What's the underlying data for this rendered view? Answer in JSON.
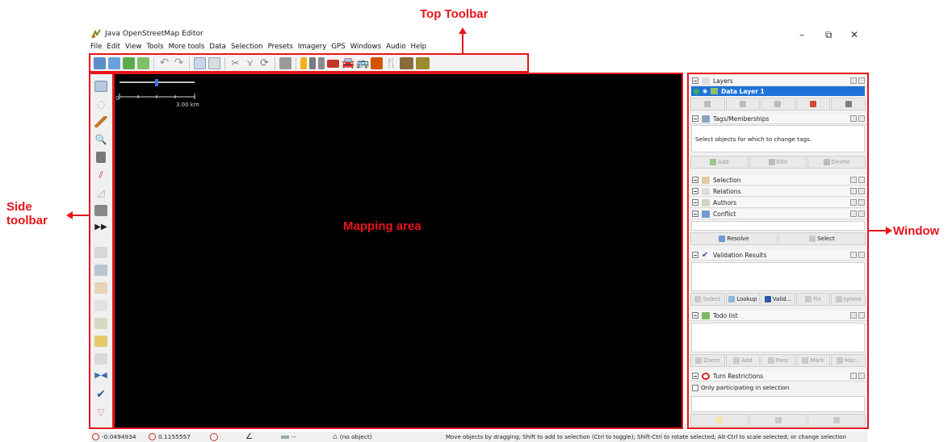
{
  "annotations": {
    "top_toolbar": "Top Toolbar",
    "side_toolbar_line1": "Side",
    "side_toolbar_line2": "toolbar",
    "mapping_area": "Mapping area",
    "window": "Window",
    "color": "#e8141b"
  },
  "app": {
    "title": "Java OpenStreetMap Editor",
    "window_controls": [
      "–",
      "⧉",
      "✕"
    ]
  },
  "menu": [
    "File",
    "Edit",
    "View",
    "Tools",
    "More tools",
    "Data",
    "Selection",
    "Presets",
    "Imagery",
    "GPS",
    "Windows",
    "Audio",
    "Help"
  ],
  "map": {
    "scale_label": "3.00 km",
    "scale_zero": "0",
    "background": "#000000"
  },
  "panels": {
    "layers": {
      "title": "Layers",
      "layer_name": "Data Layer 1"
    },
    "tags": {
      "title": "Tags/Memberships",
      "message": "Select objects for which to change tags.",
      "buttons": [
        "Add",
        "Edit",
        "Delete"
      ]
    },
    "selection": {
      "title": "Selection"
    },
    "relations": {
      "title": "Relations"
    },
    "authors": {
      "title": "Authors"
    },
    "conflict": {
      "title": "Conflict",
      "buttons": [
        "Resolve",
        "Select"
      ]
    },
    "validation": {
      "title": "Validation Results",
      "buttons": [
        "Select",
        "Lookup",
        "Valid...",
        "Fix",
        "Ignore"
      ]
    },
    "todo": {
      "title": "Todo list",
      "buttons": [
        "Zoom",
        "Add",
        "Pass",
        "Mark",
        "Mar..."
      ]
    },
    "turn": {
      "title": "Turn Restrictions",
      "checkbox_label": "Only participating in selection"
    }
  },
  "status": {
    "lat": "-0.0494934",
    "lon": "0.1155557",
    "length": "--",
    "object": "(no object)",
    "help": "Move objects by dragging; Shift to add to selection (Ctrl to toggle); Shift-Ctrl to rotate selected; Alt-Ctrl to scale selected; or change selection"
  },
  "icons": {
    "toolbar": [
      "open-icon",
      "save-icon",
      "upload-icon",
      "upload-selection-icon",
      "undo-icon",
      "redo-icon",
      "preferences-icon",
      "zoom-icon",
      "split-way-icon",
      "combine-icon",
      "refresh-icon",
      "orthogonalize-icon",
      "highway-preset-icon",
      "road-preset-icon",
      "barrier-preset-icon",
      "building-preset-icon",
      "car-icon",
      "bus-icon",
      "shop-icon",
      "restaurant-icon",
      "tourism-icon",
      "landuse-icon"
    ],
    "side": [
      "select-mode-icon",
      "lasso-icon",
      "draw-icon",
      "zoom-mode-icon",
      "delete-mode-icon",
      "parallel-icon",
      "improve-way-icon",
      "extrude-icon",
      "more-icon",
      "layers-toggle-icon",
      "tags-toggle-icon",
      "selection-toggle-icon",
      "relations-toggle-icon",
      "authors-toggle-icon",
      "notes-icon",
      "history-icon",
      "conflict-toggle-icon",
      "validation-toggle-icon",
      "filter-icon"
    ]
  }
}
